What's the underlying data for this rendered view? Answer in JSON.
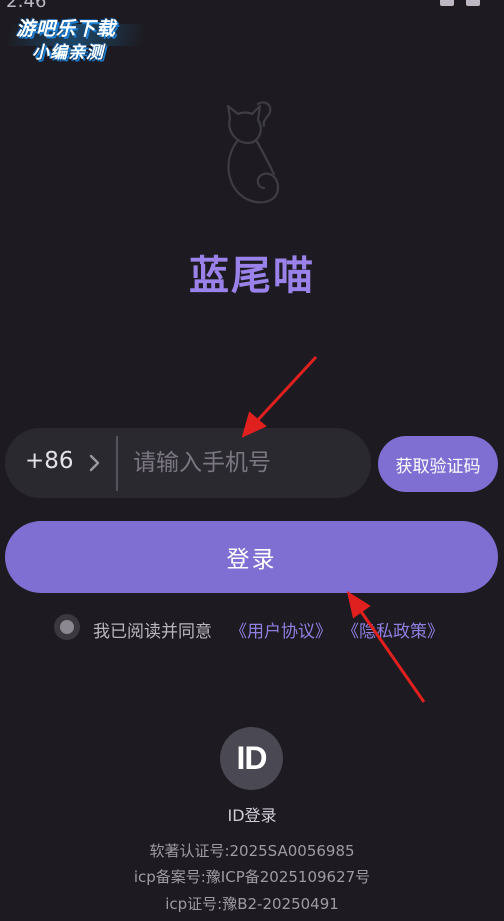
{
  "status_bar": {
    "time": "2:46"
  },
  "watermark": {
    "line1": "游吧乐下载",
    "line2": "小编亲测"
  },
  "app": {
    "title": "蓝尾喵",
    "logo_icon": "cat-outline-icon"
  },
  "login_form": {
    "country_code": "+86",
    "phone_placeholder": "请输入手机号",
    "phone_value": "",
    "get_code_label": "获取验证码",
    "login_label": "登录"
  },
  "agreement": {
    "checked": false,
    "text": "我已阅读并同意",
    "user_agreement": "《用户协议》",
    "privacy_policy": "《隐私政策》"
  },
  "id_login": {
    "icon_text": "ID",
    "label": "ID登录"
  },
  "footer": {
    "software_cert": "软著认证号:2025SA0056985",
    "icp_record": "icp备案号:豫ICP备2025109627号",
    "icp_license": "icp证号:豫B2-20250491"
  },
  "colors": {
    "background": "#1d1b21",
    "accent": "#7f6fd3",
    "title": "#9a82ea",
    "link": "#8f7fe0",
    "annotation_arrow": "#e0201e"
  }
}
